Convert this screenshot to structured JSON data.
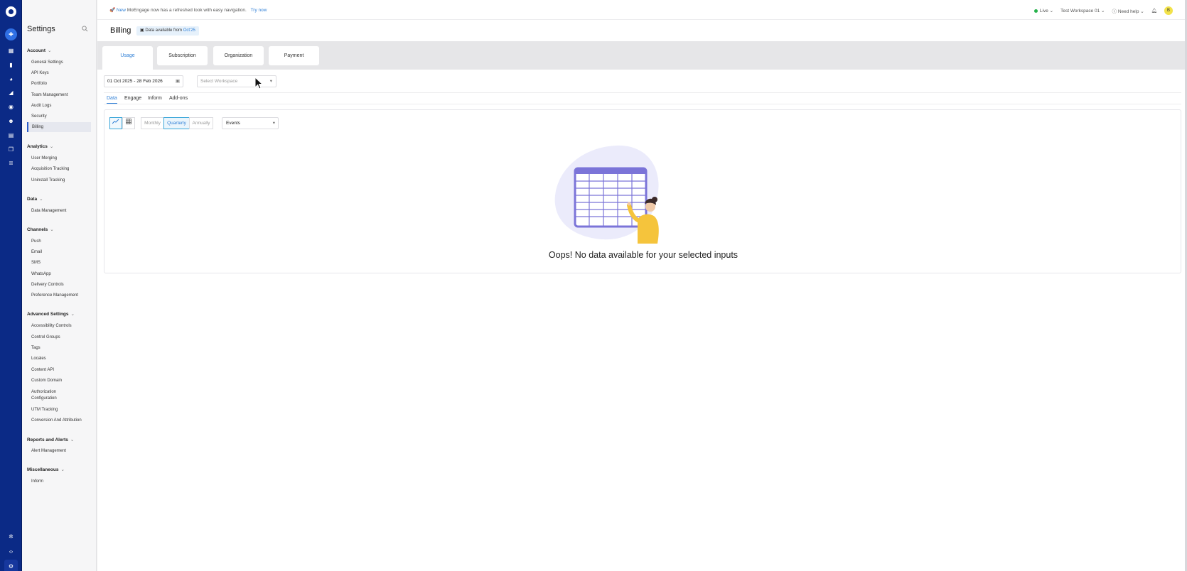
{
  "rail": {
    "icons": [
      "logo-icon",
      "plus-circle-icon",
      "dashboard-icon",
      "bar-chart-icon",
      "pie-chart-icon",
      "megaphone-icon",
      "target-icon",
      "user-icon",
      "document-icon",
      "layers-icon",
      "database-icon",
      "sparkle-icon",
      "code-icon",
      "settings-icon"
    ]
  },
  "sidebar": {
    "title": "Settings",
    "sections": [
      {
        "label": "Account",
        "items": [
          "General Settings",
          "API Keys",
          "Portfolio",
          "Team Management",
          "Audit Logs",
          "Security",
          "Billing"
        ]
      },
      {
        "label": "Analytics",
        "items": [
          "User Merging",
          "Acquisition Tracking",
          "Uninstall Tracking"
        ]
      },
      {
        "label": "Data",
        "items": [
          "Data Management"
        ]
      },
      {
        "label": "Channels",
        "items": [
          "Push",
          "Email",
          "SMS",
          "WhatsApp",
          "Delivery Controls",
          "Preference Management"
        ]
      },
      {
        "label": "Advanced Settings",
        "items": [
          "Accessibility Controls",
          "Control Groups",
          "Tags",
          "Locales",
          "Content API",
          "Custom Domain",
          "Authorization",
          "Configuration",
          "UTM Tracking",
          "Conversion And Attribution"
        ]
      },
      {
        "label": "Reports and Alerts",
        "items": [
          "Alert Management"
        ]
      },
      {
        "label": "Miscellaneous",
        "items": [
          "Inform"
        ]
      }
    ]
  },
  "topbar": {
    "new_label": "New",
    "announcement": "MoEngage now has a refreshed look with easy navigation.",
    "try_now": "Try now",
    "env": "Live",
    "workspace": "Test Workspace 01",
    "help": "Need help",
    "avatar_initial": "B"
  },
  "header": {
    "title": "Billing",
    "badge_prefix": "Data available from",
    "badge_date": "Oct'25"
  },
  "tabs": [
    "Usage",
    "Subscription",
    "Organization",
    "Payment"
  ],
  "filters": {
    "date_range": "01 Oct 2025 - 28 Feb 2026",
    "workspace_placeholder": "Select Workspace"
  },
  "subtabs": [
    "Data",
    "Engage",
    "Inform",
    "Add-ons"
  ],
  "periods": [
    "Monthly",
    "Quarterly",
    "Annually"
  ],
  "metric": "Events",
  "empty_message": "Oops! No data available for your selected inputs",
  "colors": {
    "rail": "#0b2a86",
    "accent": "#2f7fd6",
    "illustration_purple": "#7b74d8",
    "illustration_yellow": "#f5c43c"
  }
}
